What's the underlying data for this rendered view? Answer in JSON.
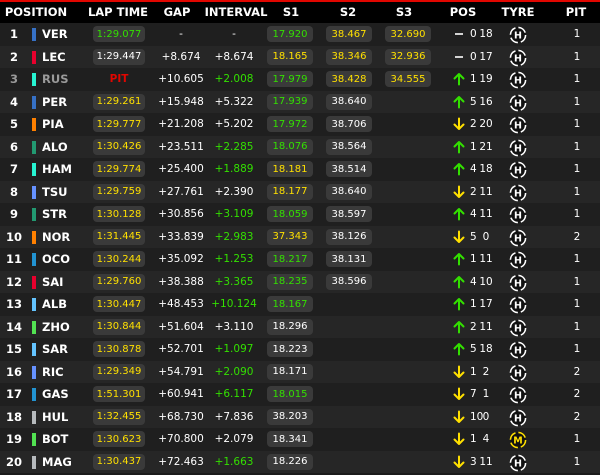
{
  "header": {
    "position": "POSITION",
    "lap_time": "LAP TIME",
    "gap": "GAP",
    "interval": "INTERVAL",
    "s1": "S1",
    "s2": "S2",
    "s3": "S3",
    "pos": "POS",
    "tyre": "TYRE",
    "pit": "PIT"
  },
  "colors": {
    "green": "#33e000",
    "yellow": "#ffe000",
    "red": "#e10600",
    "white": "#ffffff"
  },
  "rows": [
    {
      "pos": "1",
      "code": "VER",
      "team": "#3671c6",
      "lap": "1:29.077",
      "lap_color": "green",
      "gap": "-",
      "interval": "-",
      "interval_color": "white",
      "s1": "17.920",
      "s1_color": "green",
      "s2": "38.467",
      "s2_color": "yellow",
      "s3": "32.690",
      "s3_color": "yellow",
      "trend": "none",
      "change": "0",
      "tyre_age": "18",
      "tyre": "H",
      "tyre_color": "#ffffff",
      "pits": "1"
    },
    {
      "pos": "2",
      "code": "LEC",
      "team": "#e8002d",
      "lap": "1:29.447",
      "lap_color": "white",
      "gap": "+8.674",
      "interval": "+8.674",
      "interval_color": "white",
      "s1": "18.165",
      "s1_color": "yellow",
      "s2": "38.346",
      "s2_color": "yellow",
      "s3": "32.936",
      "s3_color": "yellow",
      "trend": "none",
      "change": "0",
      "tyre_age": "17",
      "tyre": "H",
      "tyre_color": "#ffffff",
      "pits": "1"
    },
    {
      "pos": "3",
      "code": "RUS",
      "team": "#27f4d2",
      "lap": "PIT",
      "lap_color": "red",
      "gap": "+10.605",
      "interval": "+2.008",
      "interval_color": "green",
      "s1": "17.979",
      "s1_color": "green",
      "s2": "38.428",
      "s2_color": "yellow",
      "s3": "34.555",
      "s3_color": "yellow",
      "trend": "up",
      "change": "1",
      "tyre_age": "19",
      "tyre": "H",
      "tyre_color": "#ffffff",
      "pits": "1",
      "dim": true
    },
    {
      "pos": "4",
      "code": "PER",
      "team": "#3671c6",
      "lap": "1:29.261",
      "lap_color": "yellow",
      "gap": "+15.948",
      "interval": "+5.322",
      "interval_color": "white",
      "s1": "17.939",
      "s1_color": "green",
      "s2": "38.640",
      "s2_color": "white",
      "s3": "",
      "s3_color": "white",
      "trend": "up",
      "change": "5",
      "tyre_age": "16",
      "tyre": "H",
      "tyre_color": "#ffffff",
      "pits": "1"
    },
    {
      "pos": "5",
      "code": "PIA",
      "team": "#ff8000",
      "lap": "1:29.777",
      "lap_color": "yellow",
      "gap": "+21.208",
      "interval": "+5.202",
      "interval_color": "white",
      "s1": "17.972",
      "s1_color": "green",
      "s2": "38.706",
      "s2_color": "white",
      "s3": "",
      "s3_color": "white",
      "trend": "down",
      "change": "2",
      "tyre_age": "20",
      "tyre": "H",
      "tyre_color": "#ffffff",
      "pits": "1"
    },
    {
      "pos": "6",
      "code": "ALO",
      "team": "#229971",
      "lap": "1:30.426",
      "lap_color": "yellow",
      "gap": "+23.511",
      "interval": "+2.285",
      "interval_color": "green",
      "s1": "18.076",
      "s1_color": "green",
      "s2": "38.564",
      "s2_color": "white",
      "s3": "",
      "s3_color": "white",
      "trend": "up",
      "change": "1",
      "tyre_age": "21",
      "tyre": "H",
      "tyre_color": "#ffffff",
      "pits": "1"
    },
    {
      "pos": "7",
      "code": "HAM",
      "team": "#27f4d2",
      "lap": "1:29.774",
      "lap_color": "yellow",
      "gap": "+25.400",
      "interval": "+1.889",
      "interval_color": "green",
      "s1": "18.181",
      "s1_color": "yellow",
      "s2": "38.514",
      "s2_color": "white",
      "s3": "",
      "s3_color": "white",
      "trend": "up",
      "change": "4",
      "tyre_age": "18",
      "tyre": "H",
      "tyre_color": "#ffffff",
      "pits": "1"
    },
    {
      "pos": "8",
      "code": "TSU",
      "team": "#6692ff",
      "lap": "1:29.759",
      "lap_color": "yellow",
      "gap": "+27.761",
      "interval": "+2.390",
      "interval_color": "white",
      "s1": "18.177",
      "s1_color": "yellow",
      "s2": "38.640",
      "s2_color": "white",
      "s3": "",
      "s3_color": "white",
      "trend": "down",
      "change": "2",
      "tyre_age": "11",
      "tyre": "H",
      "tyre_color": "#ffffff",
      "pits": "1"
    },
    {
      "pos": "9",
      "code": "STR",
      "team": "#229971",
      "lap": "1:30.128",
      "lap_color": "yellow",
      "gap": "+30.856",
      "interval": "+3.109",
      "interval_color": "green",
      "s1": "18.059",
      "s1_color": "green",
      "s2": "38.597",
      "s2_color": "white",
      "s3": "",
      "s3_color": "white",
      "trend": "up",
      "change": "4",
      "tyre_age": "11",
      "tyre": "H",
      "tyre_color": "#ffffff",
      "pits": "1"
    },
    {
      "pos": "10",
      "code": "NOR",
      "team": "#ff8000",
      "lap": "1:31.445",
      "lap_color": "yellow",
      "gap": "+33.839",
      "interval": "+2.983",
      "interval_color": "green",
      "s1": "37.343",
      "s1_color": "yellow",
      "s2": "38.126",
      "s2_color": "white",
      "s3": "",
      "s3_color": "white",
      "trend": "down",
      "change": "5",
      "tyre_age": "0",
      "tyre": "H",
      "tyre_color": "#ffffff",
      "pits": "2"
    },
    {
      "pos": "11",
      "code": "OCO",
      "team": "#2293d1",
      "lap": "1:30.244",
      "lap_color": "yellow",
      "gap": "+35.092",
      "interval": "+1.253",
      "interval_color": "green",
      "s1": "18.217",
      "s1_color": "green",
      "s2": "38.131",
      "s2_color": "white",
      "s3": "",
      "s3_color": "white",
      "trend": "up",
      "change": "1",
      "tyre_age": "11",
      "tyre": "H",
      "tyre_color": "#ffffff",
      "pits": "1"
    },
    {
      "pos": "12",
      "code": "SAI",
      "team": "#e8002d",
      "lap": "1:29.760",
      "lap_color": "yellow",
      "gap": "+38.388",
      "interval": "+3.365",
      "interval_color": "green",
      "s1": "18.235",
      "s1_color": "green",
      "s2": "38.596",
      "s2_color": "white",
      "s3": "",
      "s3_color": "white",
      "trend": "up",
      "change": "4",
      "tyre_age": "10",
      "tyre": "H",
      "tyre_color": "#ffffff",
      "pits": "1"
    },
    {
      "pos": "13",
      "code": "ALB",
      "team": "#64c4ff",
      "lap": "1:30.447",
      "lap_color": "yellow",
      "gap": "+48.453",
      "interval": "+10.124",
      "interval_color": "green",
      "s1": "18.167",
      "s1_color": "green",
      "s2": "",
      "s2_color": "white",
      "s3": "",
      "s3_color": "white",
      "trend": "up",
      "change": "1",
      "tyre_age": "17",
      "tyre": "H",
      "tyre_color": "#ffffff",
      "pits": "1"
    },
    {
      "pos": "14",
      "code": "ZHO",
      "team": "#52e252",
      "lap": "1:30.844",
      "lap_color": "yellow",
      "gap": "+51.604",
      "interval": "+3.110",
      "interval_color": "white",
      "s1": "18.296",
      "s1_color": "white",
      "s2": "",
      "s2_color": "white",
      "s3": "",
      "s3_color": "white",
      "trend": "up",
      "change": "2",
      "tyre_age": "11",
      "tyre": "H",
      "tyre_color": "#ffffff",
      "pits": "1"
    },
    {
      "pos": "15",
      "code": "SAR",
      "team": "#64c4ff",
      "lap": "1:30.878",
      "lap_color": "yellow",
      "gap": "+52.701",
      "interval": "+1.097",
      "interval_color": "green",
      "s1": "18.223",
      "s1_color": "white",
      "s2": "",
      "s2_color": "white",
      "s3": "",
      "s3_color": "white",
      "trend": "up",
      "change": "5",
      "tyre_age": "18",
      "tyre": "H",
      "tyre_color": "#ffffff",
      "pits": "1"
    },
    {
      "pos": "16",
      "code": "RIC",
      "team": "#6692ff",
      "lap": "1:29.349",
      "lap_color": "yellow",
      "gap": "+54.791",
      "interval": "+2.090",
      "interval_color": "green",
      "s1": "18.171",
      "s1_color": "white",
      "s2": "",
      "s2_color": "white",
      "s3": "",
      "s3_color": "white",
      "trend": "down",
      "change": "1",
      "tyre_age": "2",
      "tyre": "H",
      "tyre_color": "#ffffff",
      "pits": "2"
    },
    {
      "pos": "17",
      "code": "GAS",
      "team": "#2293d1",
      "lap": "1:51.301",
      "lap_color": "yellow",
      "gap": "+60.941",
      "interval": "+6.117",
      "interval_color": "green",
      "s1": "18.015",
      "s1_color": "green",
      "s2": "",
      "s2_color": "white",
      "s3": "",
      "s3_color": "white",
      "trend": "down",
      "change": "7",
      "tyre_age": "1",
      "tyre": "H",
      "tyre_color": "#ffffff",
      "pits": "2"
    },
    {
      "pos": "18",
      "code": "HUL",
      "team": "#b6babd",
      "lap": "1:32.455",
      "lap_color": "yellow",
      "gap": "+68.730",
      "interval": "+7.836",
      "interval_color": "white",
      "s1": "38.203",
      "s1_color": "white",
      "s2": "",
      "s2_color": "white",
      "s3": "",
      "s3_color": "white",
      "trend": "down",
      "change": "10",
      "tyre_age": "0",
      "tyre": "H",
      "tyre_color": "#ffffff",
      "pits": "2"
    },
    {
      "pos": "19",
      "code": "BOT",
      "team": "#52e252",
      "lap": "1:30.623",
      "lap_color": "yellow",
      "gap": "+70.800",
      "interval": "+2.079",
      "interval_color": "white",
      "s1": "18.341",
      "s1_color": "white",
      "s2": "",
      "s2_color": "white",
      "s3": "",
      "s3_color": "white",
      "trend": "down",
      "change": "1",
      "tyre_age": "4",
      "tyre": "M",
      "tyre_color": "#ffe000",
      "pits": "1"
    },
    {
      "pos": "20",
      "code": "MAG",
      "team": "#b6babd",
      "lap": "1:30.437",
      "lap_color": "yellow",
      "gap": "+72.463",
      "interval": "+1.663",
      "interval_color": "green",
      "s1": "18.226",
      "s1_color": "white",
      "s2": "",
      "s2_color": "white",
      "s3": "",
      "s3_color": "white",
      "trend": "down",
      "change": "3",
      "tyre_age": "11",
      "tyre": "H",
      "tyre_color": "#ffffff",
      "pits": "1"
    }
  ]
}
